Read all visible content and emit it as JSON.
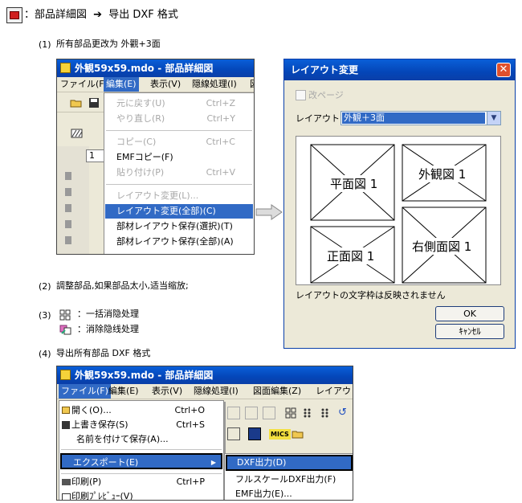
{
  "header": {
    "arrow": "➔",
    "text_before": "：部品詳細図",
    "text_after": "导出 DXF 格式"
  },
  "steps": [
    {
      "num": "(1)",
      "text": "所有部品更改为 外觀+3面"
    },
    {
      "num": "(2)",
      "text": "調整部品,如果部品太小,适当缩放;"
    },
    {
      "num": "(3)",
      "text": ""
    },
    {
      "num": "(4)",
      "text": "导出所有部品 DXF 格式"
    }
  ],
  "step3": {
    "line1": "：一括消隐处理",
    "line2": "：消除隐线处理"
  },
  "window1": {
    "title": "外観59x59.mdo - 部品詳細図",
    "menus": [
      "ファイル(F)",
      "編集(E)",
      "表示(V)",
      "隠線処理(I)",
      "図"
    ],
    "toolbar_field": "1",
    "edit_menu": [
      {
        "label": "元に戻す(U)",
        "shortcut": "Ctrl+Z"
      },
      {
        "label": "やり直し(R)",
        "shortcut": "Ctrl+Y"
      },
      {
        "label": "コピー(C)",
        "shortcut": "Ctrl+C"
      },
      {
        "label": "EMFコピー(F)",
        "shortcut": ""
      },
      {
        "label": "貼り付け(P)",
        "shortcut": "Ctrl+V"
      },
      {
        "label": "レイアウト変更(L)...",
        "shortcut": ""
      },
      {
        "label": "レイアウト変更(全部)(C)",
        "shortcut": ""
      },
      {
        "label": "部材レイアウト保存(選択)(T)",
        "shortcut": ""
      },
      {
        "label": "部材レイアウト保存(全部)(A)",
        "shortcut": ""
      }
    ]
  },
  "dialog": {
    "title": "レイアウト変更",
    "checkbox_label": "改ページ",
    "layout_label": "レイアウト",
    "layout_value": "外観＋3面",
    "panels": [
      "平面図 1",
      "外観図 1",
      "正面図 1",
      "右側面図 1"
    ],
    "note": "レイアウトの文字枠は反映されません",
    "ok": "OK",
    "cancel": "ｷｬﾝｾﾙ"
  },
  "window2": {
    "title": "外観59x59.mdo - 部品詳細図",
    "menus": [
      "ファイル(F)",
      "編集(E)",
      "表示(V)",
      "隠線処理(I)",
      "図面編集(Z)",
      "レイアウト"
    ],
    "file_menu": [
      {
        "label": "開く(O)...",
        "shortcut": "Ctrl+O"
      },
      {
        "label": "上書き保存(S)",
        "shortcut": "Ctrl+S"
      },
      {
        "label": "名前を付けて保存(A)...",
        "shortcut": ""
      },
      {
        "label": "エクスポート(E)",
        "shortcut": ""
      },
      {
        "label": "印刷(P)",
        "shortcut": "Ctrl+P"
      },
      {
        "label": "印刷ﾌﾟﾚﾋﾞｭｰ(V)",
        "shortcut": ""
      }
    ],
    "submenu": [
      "DXF出力(D)",
      "フルスケールDXF出力(F)",
      "EMF出力(E)..."
    ],
    "mics": "MICS"
  },
  "colors": {
    "title_blue": "#0a4fc4",
    "highlight": "#316ac5",
    "close_red": "#e0502c"
  }
}
